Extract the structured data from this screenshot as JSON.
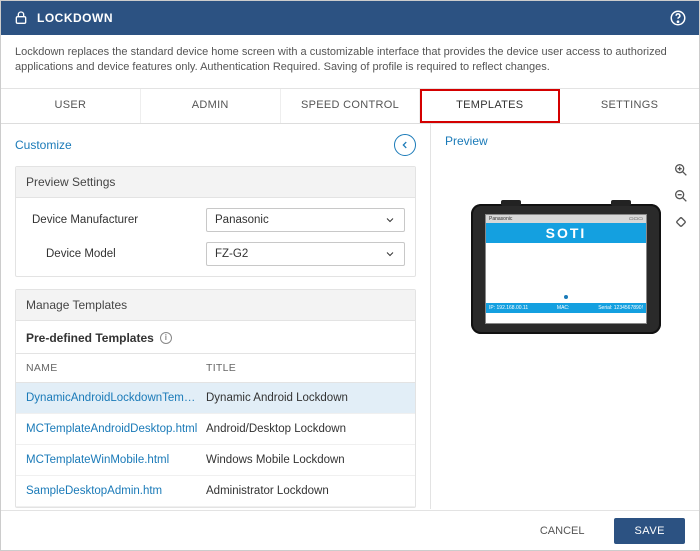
{
  "header": {
    "title": "LOCKDOWN"
  },
  "description": "Lockdown replaces the standard device home screen with a customizable interface that provides the device user access to authorized applications and device features only. Authentication Required. Saving of profile is required to reflect changes.",
  "tabs": {
    "user": "USER",
    "admin": "ADMIN",
    "speed": "SPEED CONTROL",
    "templates": "TEMPLATES",
    "settings": "SETTINGS"
  },
  "left": {
    "customize": "Customize",
    "preview_settings": "Preview Settings",
    "manufacturer_label": "Device Manufacturer",
    "manufacturer_value": "Panasonic",
    "model_label": "Device Model",
    "model_value": "FZ-G2",
    "manage_templates": "Manage Templates",
    "predefined": "Pre-defined Templates",
    "col_name": "NAME",
    "col_title": "TITLE",
    "rows": [
      {
        "name": "DynamicAndroidLockdownTemplate.…",
        "title": "Dynamic Android Lockdown"
      },
      {
        "name": "MCTemplateAndroidDesktop.html",
        "title": "Android/Desktop Lockdown"
      },
      {
        "name": "MCTemplateWinMobile.html",
        "title": "Windows Mobile Lockdown"
      },
      {
        "name": "SampleDesktopAdmin.htm",
        "title": "Administrator Lockdown"
      }
    ]
  },
  "right": {
    "preview": "Preview",
    "device_brand": "Panasonic",
    "screen_brand": "SOTI",
    "ip_label": "IP: 192.168.00.11",
    "mac_label": "MAC:",
    "serial_label": "Serial:",
    "serial_value": "1234567890!"
  },
  "footer": {
    "cancel": "CANCEL",
    "save": "SAVE"
  }
}
